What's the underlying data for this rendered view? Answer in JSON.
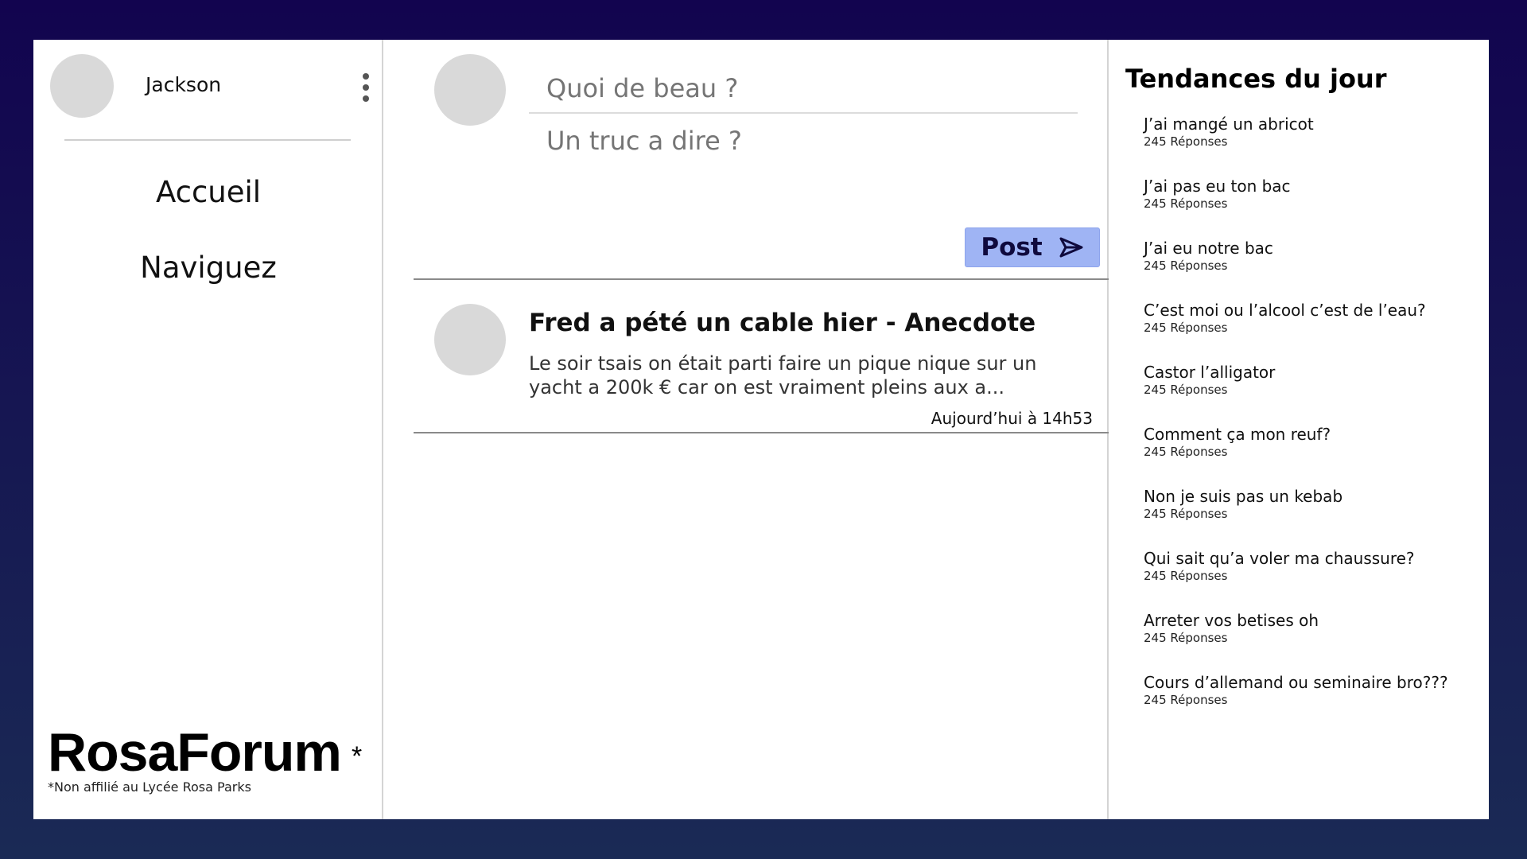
{
  "user": {
    "name": "Jackson"
  },
  "nav": {
    "items": [
      {
        "label": "Accueil"
      },
      {
        "label": "Naviguez"
      }
    ]
  },
  "brand": {
    "name": "RosaForum",
    "star": "*",
    "disclaimer": "*Non affilié au Lycée Rosa Parks"
  },
  "compose": {
    "title_placeholder": "Quoi de beau ?",
    "body_placeholder": "Un truc a dire ?",
    "post_label": "Post"
  },
  "posts": [
    {
      "title": "Fred a pété un cable hier - Anecdote",
      "excerpt": "Le soir tsais on était parti faire un pique nique sur un yacht a 200k € car on est vraiment pleins aux a...",
      "time": "Aujourd’hui à 14h53"
    }
  ],
  "trends": {
    "title": "Tendances du jour",
    "items": [
      {
        "topic": "J’ai mangé un abricot",
        "replies": "245 Réponses"
      },
      {
        "topic": "J’ai pas eu ton bac",
        "replies": "245 Réponses"
      },
      {
        "topic": "J’ai eu notre bac",
        "replies": "245 Réponses"
      },
      {
        "topic": "C’est moi ou l’alcool c’est de l’eau?",
        "replies": "245 Réponses"
      },
      {
        "topic": "Castor l’alligator",
        "replies": "245 Réponses"
      },
      {
        "topic": "Comment ça mon reuf?",
        "replies": "245 Réponses"
      },
      {
        "topic": "Non je suis pas un kebab",
        "replies": "245 Réponses"
      },
      {
        "topic": "Qui sait qu’a voler ma chaussure?",
        "replies": "245 Réponses"
      },
      {
        "topic": "Arreter vos betises oh",
        "replies": "245 Réponses"
      },
      {
        "topic": "Cours d’allemand ou seminaire bro???",
        "replies": "245 Réponses"
      }
    ]
  },
  "colors": {
    "background_top": "#12044f",
    "background_bottom": "#1a2a55",
    "post_button": "#9fb4f4",
    "post_button_text": "#0f0a3d",
    "avatar": "#d9d9d9"
  },
  "icons": {
    "menu": "kebab-icon",
    "send": "send-icon"
  }
}
